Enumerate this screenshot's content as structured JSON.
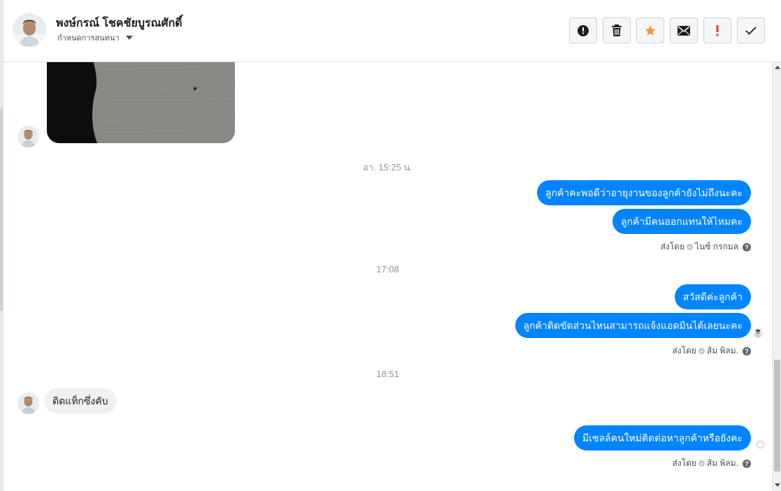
{
  "header": {
    "name": "พงษ์กรณ์ โชคชัยบูรณศักดิ์",
    "assign_label": "กำหนดการสนทนา"
  },
  "actions": [
    {
      "name": "spam",
      "icon": "alert-circle-icon"
    },
    {
      "name": "delete",
      "icon": "trash-icon"
    },
    {
      "name": "star",
      "icon": "star-icon",
      "color": "#f7923b"
    },
    {
      "name": "mark-unread",
      "icon": "envelope-icon"
    },
    {
      "name": "follow-up",
      "icon": "exclamation-icon",
      "color": "#e53935"
    },
    {
      "name": "done",
      "icon": "check-icon"
    }
  ],
  "messages": {
    "stamp1": "อา. 15:25 น.",
    "out1a": "ลูกค้าคะพอดีว่าอายุงานของลูกค้ายังไม่ถึงนะคะ",
    "out1b": "ลูกค้ามีคนออกแทนให้ไหมคะ",
    "sent_prefix": "ส่งโดย",
    "sender1": "ไนซ์ กรกมล",
    "stamp2": "17:08",
    "out2a": "สวัสดีค่ะลูกค้า",
    "out2b": "ลูกค้าติดขัดส่วนไหนสามารถแจ้งแอดมินได้เลยนะคะ",
    "sender2": "ส้ม พิลม.",
    "stamp3": "18:51",
    "in1": "ติดแท็กซึ่งคับ",
    "out3": "มีเซลล์คนใหม่ติดต่อหาลูกค้าหรือยังคะ",
    "sender3": "ส้ม พิลม."
  },
  "colors": {
    "accent": "#0084ff",
    "incoming_bubble": "#f1f0f0",
    "muted_text": "#90949c"
  }
}
